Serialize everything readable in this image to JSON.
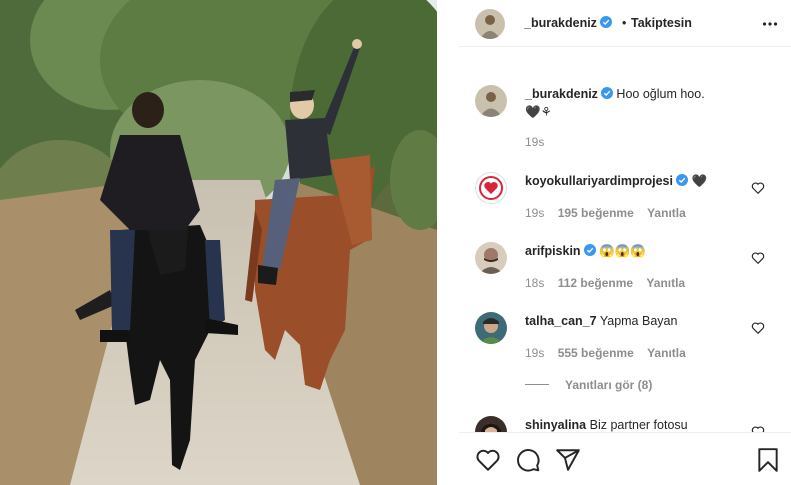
{
  "post": {
    "username": "_burakdeniz",
    "separator": "•",
    "follow_status": "Takiptesin",
    "caption": "Hoo oğlum hoo.",
    "caption_emoji": "🖤⚘",
    "caption_time": "19s"
  },
  "comments": [
    {
      "username": "koyokullariyardimprojesi",
      "text": "🖤",
      "time": "19s",
      "likes": "195 beğenme",
      "reply": "Yanıtla"
    },
    {
      "username": "arifpiskin",
      "text": "😱😱😱",
      "time": "18s",
      "likes": "112 beğenme",
      "reply": "Yanıtla"
    },
    {
      "username": "talha_can_7",
      "text": "Yapma Bayan",
      "time": "19s",
      "likes": "555 beğenme",
      "reply": "Yanıtla",
      "view_replies": "Yanıtları gör (8)"
    },
    {
      "username": "shinyalina",
      "text": "Biz partner fotosu"
    }
  ],
  "colors": {
    "verified": "#3897f0",
    "text": "#262626",
    "meta": "#8e8e8e",
    "border": "#efefef"
  },
  "icons": [
    "more-icon",
    "verified-icon",
    "heart-icon",
    "comment-icon",
    "share-icon",
    "bookmark-icon"
  ]
}
